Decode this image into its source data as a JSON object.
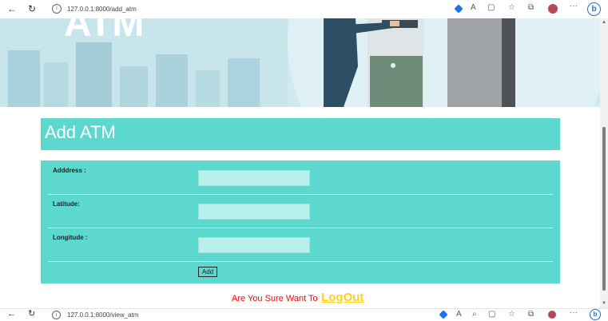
{
  "browser": {
    "current_url": "127.0.0.1:8000/add_atm",
    "status_url": "127.0.0.1:8000/view_atm",
    "accent": "#1a73e8"
  },
  "page": {
    "title": "Add ATM",
    "accent": "#5cd8cf"
  },
  "form": {
    "fields": [
      {
        "label": "Adddress :",
        "value": ""
      },
      {
        "label": "Latitude:",
        "value": ""
      },
      {
        "label": "Longitude :",
        "value": ""
      }
    ],
    "submit_label": "Add"
  },
  "footer": {
    "prompt": "Are You Sure Want To",
    "logout_label": "LogOut",
    "prompt_color": "#ff0000",
    "link_color": "#ffd21c"
  },
  "icons": [
    "back-icon",
    "refresh-icon",
    "info-icon",
    "tag-icon",
    "read-aloud-icon",
    "tab-icon",
    "favorites-icon",
    "collections-icon",
    "profile-icon",
    "more-icon",
    "bing-icon",
    "zoom-icon"
  ]
}
